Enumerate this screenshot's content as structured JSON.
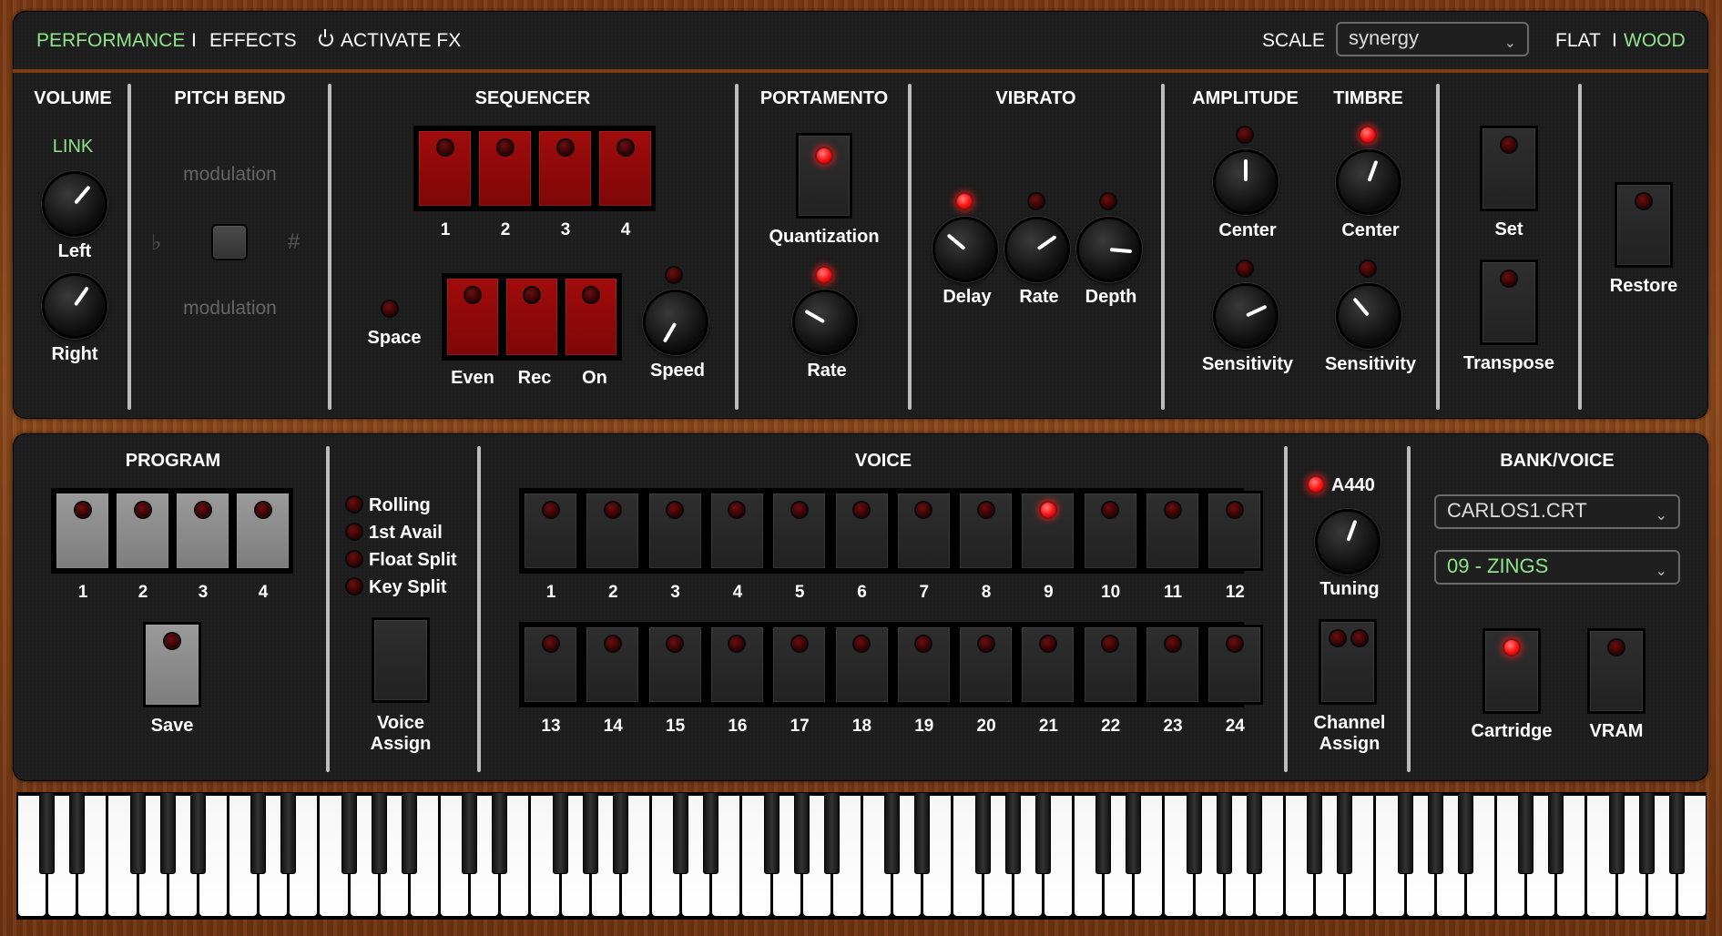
{
  "topbar": {
    "tabs": [
      {
        "label": "PERFORMANCE",
        "active": true
      },
      {
        "label": "EFFECTS",
        "active": false
      }
    ],
    "separator": "I",
    "activate_fx_icon": "power-icon",
    "activate_fx": "ACTIVATE FX",
    "scale_label": "SCALE",
    "scale_value": "synergy",
    "skin_flat": "FLAT",
    "skin_sep": "I",
    "skin_wood": "WOOD"
  },
  "colors": {
    "accent_green": "#8fe68a",
    "led_on": "#ff1a1a",
    "button_red": "#9a0b0b",
    "panel": "#1d1d1d"
  },
  "performance": {
    "volume": {
      "title": "VOLUME",
      "link": "LINK",
      "left": "Left",
      "right": "Right"
    },
    "pitch_bend": {
      "title": "PITCH BEND",
      "mod_top": "modulation",
      "mod_bottom": "modulation",
      "flat_symbol": "♭",
      "sharp_symbol": "#"
    },
    "sequencer": {
      "title": "SEQUENCER",
      "steps": [
        "1",
        "2",
        "3",
        "4"
      ],
      "space": "Space",
      "buttons": [
        "Even",
        "Rec",
        "On"
      ],
      "speed": "Speed"
    },
    "portamento": {
      "title": "PORTAMENTO",
      "quantization": "Quantization",
      "rate": "Rate"
    },
    "vibrato": {
      "title": "VIBRATO",
      "delay": "Delay",
      "rate": "Rate",
      "depth": "Depth"
    },
    "amplitude": {
      "title": "AMPLITUDE",
      "center": "Center",
      "sensitivity": "Sensitivity"
    },
    "timbre": {
      "title": "TIMBRE",
      "center": "Center",
      "sensitivity": "Sensitivity"
    },
    "transpose": {
      "set": "Set",
      "transpose": "Transpose"
    },
    "restore": "Restore"
  },
  "program": {
    "title": "PROGRAM",
    "buttons": [
      "1",
      "2",
      "3",
      "4"
    ],
    "save": "Save"
  },
  "voice_assign": {
    "modes": [
      "Rolling",
      "1st Avail",
      "Float Split",
      "Key Split"
    ],
    "label_line1": "Voice",
    "label_line2": "Assign"
  },
  "voice": {
    "title": "VOICE",
    "row1": [
      "1",
      "2",
      "3",
      "4",
      "5",
      "6",
      "7",
      "8",
      "9",
      "10",
      "11",
      "12"
    ],
    "row2": [
      "13",
      "14",
      "15",
      "16",
      "17",
      "18",
      "19",
      "20",
      "21",
      "22",
      "23",
      "24"
    ],
    "active": "9"
  },
  "tuning": {
    "a440": "A440",
    "tuning": "Tuning",
    "channel_line1": "Channel",
    "channel_line2": "Assign"
  },
  "bank_voice": {
    "title": "BANK/VOICE",
    "bank": "CARLOS1.CRT",
    "voice": "09 - ZINGS",
    "cartridge": "Cartridge",
    "vram": "VRAM"
  }
}
